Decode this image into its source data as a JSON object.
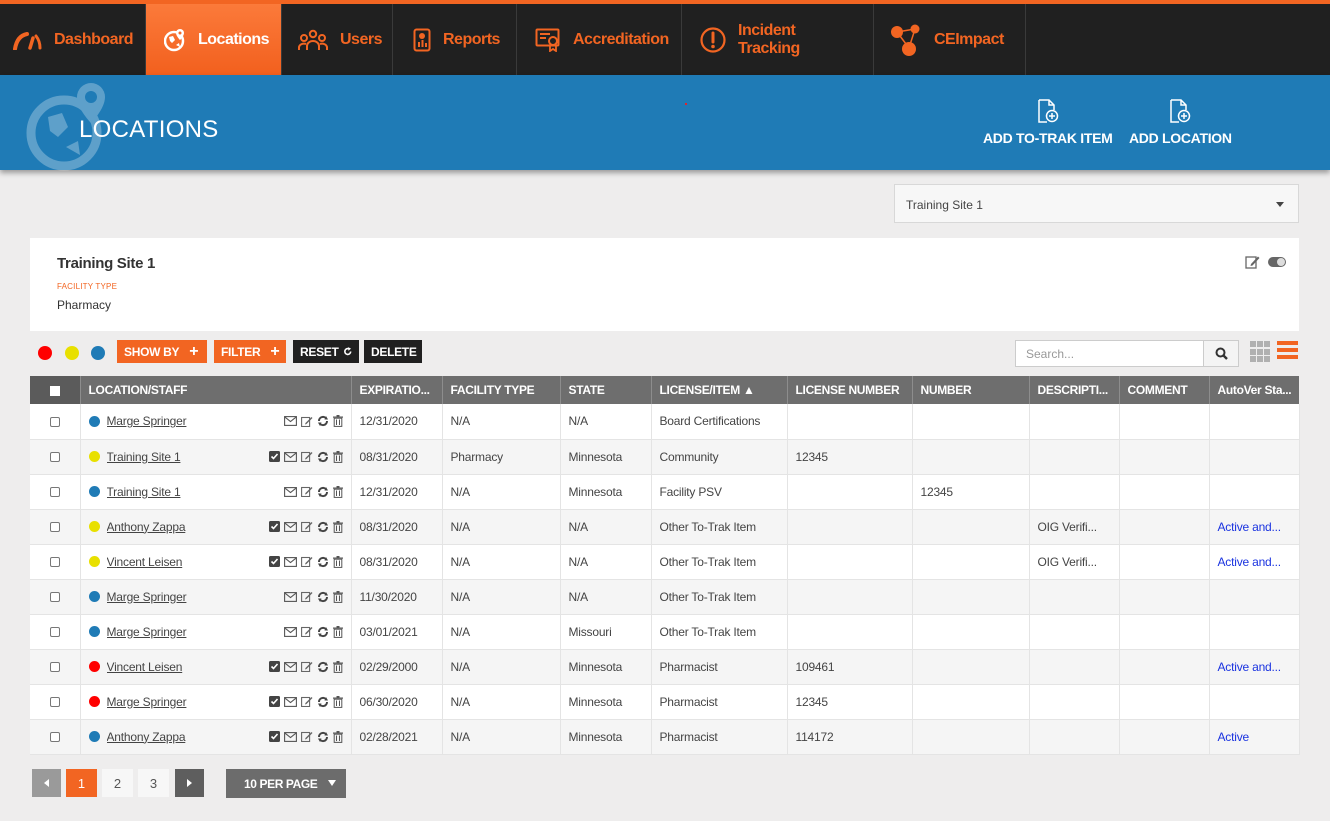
{
  "nav": {
    "items": [
      {
        "label": "Dashboard",
        "icon": "speedometer-icon",
        "active": false
      },
      {
        "label": "Locations",
        "icon": "globe-pin-icon",
        "active": true
      },
      {
        "label": "Users",
        "icon": "users-icon",
        "active": false
      },
      {
        "label": "Reports",
        "icon": "report-icon",
        "active": false
      },
      {
        "label": "Accreditation",
        "icon": "certificate-icon",
        "active": false
      },
      {
        "label": "Incident Tracking",
        "icon": "alert-circle-icon",
        "active": false
      },
      {
        "label": "CEImpact",
        "icon": "network-nodes-icon",
        "active": false
      }
    ]
  },
  "banner": {
    "title": "LOCATIONS",
    "actions": {
      "add_trak": "ADD TO-TRAK ITEM",
      "add_location": "ADD LOCATION"
    }
  },
  "site_selector": {
    "value": "Training Site 1"
  },
  "info_card": {
    "name": "Training Site 1",
    "facility_type_label": "FACILITY TYPE",
    "facility_type_value": "Pharmacy"
  },
  "toolbar": {
    "legend_colors": {
      "red": "#ff0000",
      "yellow": "#e8e000",
      "blue": "#1f7bb6"
    },
    "show_by": "SHOW BY",
    "filter": "FILTER",
    "reset": "RESET",
    "delete": "DELETE",
    "search_placeholder": "Search..."
  },
  "table": {
    "headers": [
      "LOCATION/STAFF",
      "EXPIRATIO...",
      "FACILITY TYPE",
      "STATE",
      "LICENSE/ITEM ▲",
      "LICENSE NUMBER",
      "NUMBER",
      "DESCRIPTI...",
      "COMMENT",
      "AutoVer Sta..."
    ],
    "rows": [
      {
        "status": "blue",
        "name": "Marge Springer",
        "verified": false,
        "expiration": "12/31/2020",
        "facility_type": "N/A",
        "state": "N/A",
        "license_item": "Board Certifications",
        "license_number": "",
        "number": "",
        "description": "",
        "comment": "",
        "autover": ""
      },
      {
        "status": "yellow",
        "name": "Training Site 1",
        "verified": true,
        "expiration": "08/31/2020",
        "facility_type": "Pharmacy",
        "state": "Minnesota",
        "license_item": "Community",
        "license_number": "12345",
        "number": "",
        "description": "",
        "comment": "",
        "autover": ""
      },
      {
        "status": "blue",
        "name": "Training Site 1",
        "verified": false,
        "expiration": "12/31/2020",
        "facility_type": "N/A",
        "state": "Minnesota",
        "license_item": "Facility PSV",
        "license_number": "",
        "number": "12345",
        "description": "",
        "comment": "",
        "autover": ""
      },
      {
        "status": "yellow",
        "name": "Anthony Zappa",
        "verified": true,
        "expiration": "08/31/2020",
        "facility_type": "N/A",
        "state": "N/A",
        "license_item": "Other To-Trak Item",
        "license_number": "",
        "number": "",
        "description": "OIG Verifi...",
        "comment": "",
        "autover": "Active and..."
      },
      {
        "status": "yellow",
        "name": "Vincent Leisen",
        "verified": true,
        "expiration": "08/31/2020",
        "facility_type": "N/A",
        "state": "N/A",
        "license_item": "Other To-Trak Item",
        "license_number": "",
        "number": "",
        "description": "OIG Verifi...",
        "comment": "",
        "autover": "Active and..."
      },
      {
        "status": "blue",
        "name": "Marge Springer",
        "verified": false,
        "expiration": "11/30/2020",
        "facility_type": "N/A",
        "state": "N/A",
        "license_item": "Other To-Trak Item",
        "license_number": "",
        "number": "",
        "description": "",
        "comment": "",
        "autover": ""
      },
      {
        "status": "blue",
        "name": "Marge Springer",
        "verified": false,
        "expiration": "03/01/2021",
        "facility_type": "N/A",
        "state": "Missouri",
        "license_item": "Other To-Trak Item",
        "license_number": "",
        "number": "",
        "description": "",
        "comment": "",
        "autover": ""
      },
      {
        "status": "red",
        "name": "Vincent Leisen",
        "verified": true,
        "expiration": "02/29/2000",
        "facility_type": "N/A",
        "state": "Minnesota",
        "license_item": "Pharmacist",
        "license_number": "109461",
        "number": "",
        "description": "",
        "comment": "",
        "autover": "Active and..."
      },
      {
        "status": "red",
        "name": "Marge Springer",
        "verified": true,
        "expiration": "06/30/2020",
        "facility_type": "N/A",
        "state": "Minnesota",
        "license_item": "Pharmacist",
        "license_number": "12345",
        "number": "",
        "description": "",
        "comment": "",
        "autover": ""
      },
      {
        "status": "blue",
        "name": "Anthony Zappa",
        "verified": true,
        "expiration": "02/28/2021",
        "facility_type": "N/A",
        "state": "Minnesota",
        "license_item": "Pharmacist",
        "license_number": "114172",
        "number": "",
        "description": "",
        "comment": "",
        "autover": "Active"
      }
    ]
  },
  "pagination": {
    "pages": [
      "1",
      "2",
      "3"
    ],
    "current": "1",
    "per_page": "10 PER PAGE"
  }
}
